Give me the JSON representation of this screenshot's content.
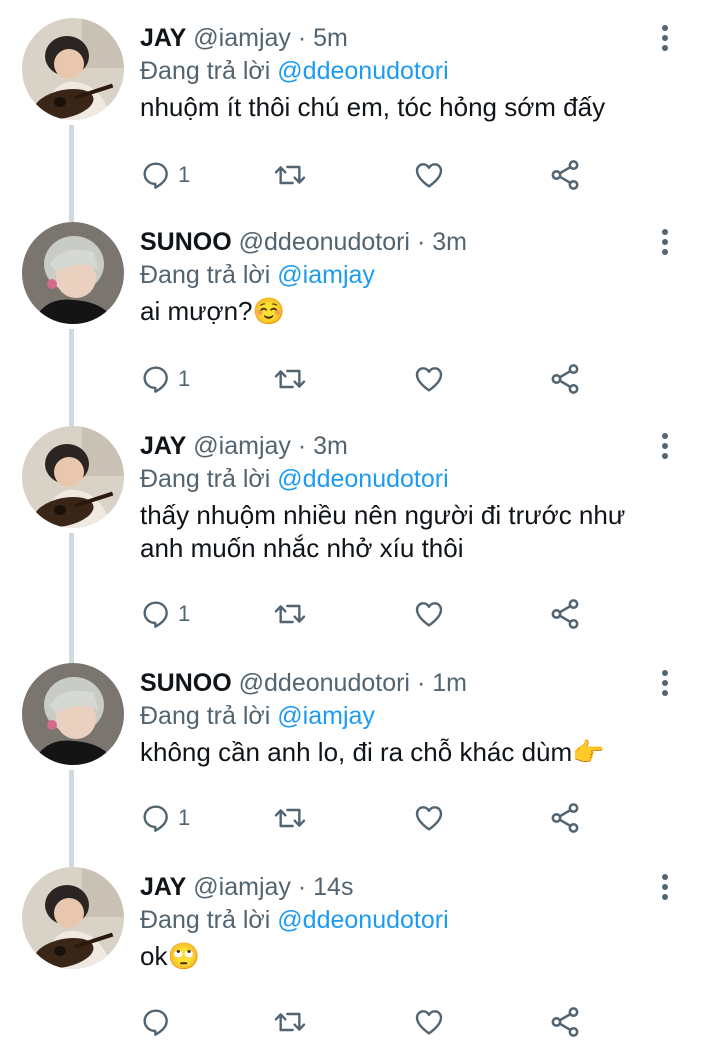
{
  "colors": {
    "name": "#0f1419",
    "meta": "#536471",
    "mention": "#1d9bf0",
    "thread_line": "#cfd9de"
  },
  "tweets": [
    {
      "author": "JAY",
      "handle": "@iamjay",
      "separator": "·",
      "time": "5m",
      "reply_prefix": "Đang trả lời",
      "reply_to": "@ddeonudotori",
      "text": "nhuộm ít thôi chú em, tóc hỏng sớm đấy",
      "reply_count": "1",
      "avatar": "jay-avatar"
    },
    {
      "author": "SUNOO",
      "handle": "@ddeonudotori",
      "separator": "·",
      "time": "3m",
      "reply_prefix": "Đang trả lời",
      "reply_to": "@iamjay",
      "text": "ai mượn?☺️",
      "reply_count": "1",
      "avatar": "sunoo-avatar"
    },
    {
      "author": "JAY",
      "handle": "@iamjay",
      "separator": "·",
      "time": "3m",
      "reply_prefix": "Đang trả lời",
      "reply_to": "@ddeonudotori",
      "text": "thấy nhuộm nhiều nên người đi trước như\nanh muốn nhắc nhở xíu thôi",
      "reply_count": "1",
      "avatar": "jay-avatar"
    },
    {
      "author": "SUNOO",
      "handle": "@ddeonudotori",
      "separator": "·",
      "time": "1m",
      "reply_prefix": "Đang trả lời",
      "reply_to": "@iamjay",
      "text": "không cần anh lo, đi ra chỗ khác dùm👉",
      "reply_count": "1",
      "avatar": "sunoo-avatar"
    },
    {
      "author": "JAY",
      "handle": "@iamjay",
      "separator": "·",
      "time": "14s",
      "reply_prefix": "Đang trả lời",
      "reply_to": "@ddeonudotori",
      "text": "ok🙄",
      "reply_count": "",
      "avatar": "jay-avatar"
    }
  ],
  "icons": {
    "reply": "reply-icon",
    "retweet": "retweet-icon",
    "like": "heart-icon",
    "share": "share-icon",
    "more": "more-vertical-icon"
  }
}
